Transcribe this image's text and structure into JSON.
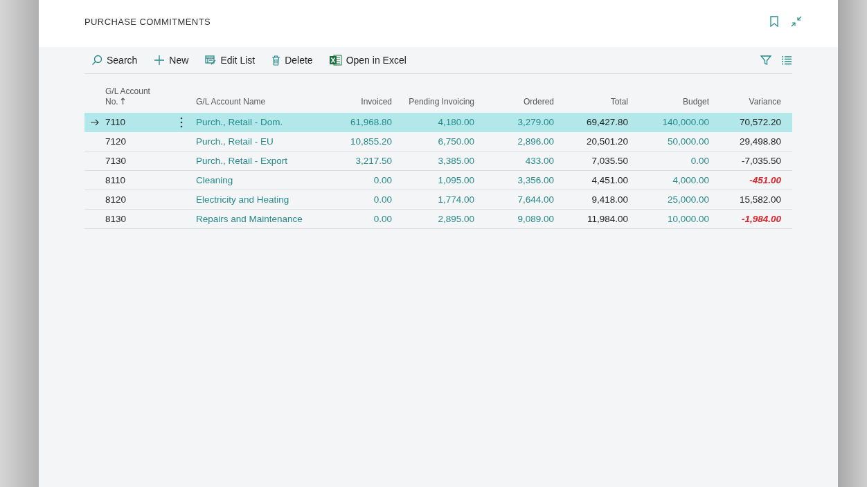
{
  "page": {
    "title": "PURCHASE COMMITMENTS"
  },
  "toolbar": {
    "actions": [
      {
        "kind": "search",
        "label": "Search"
      },
      {
        "kind": "new",
        "label": "New"
      },
      {
        "kind": "edit",
        "label": "Edit List"
      },
      {
        "kind": "delete",
        "label": "Delete"
      },
      {
        "kind": "excel",
        "label": "Open in Excel"
      }
    ]
  },
  "table": {
    "columns": [
      {
        "label": "G/L Account No.",
        "sorted": true
      },
      {
        "label": "G/L Account Name",
        "sorted": false
      },
      {
        "label": "Invoiced",
        "sorted": false
      },
      {
        "label": "Pending Invoicing",
        "sorted": false
      },
      {
        "label": "Ordered",
        "sorted": false
      },
      {
        "label": "Total",
        "sorted": false
      },
      {
        "label": "Budget",
        "sorted": false
      },
      {
        "label": "Variance",
        "sorted": false
      }
    ],
    "rows": [
      {
        "selected": true,
        "cells": [
          {
            "text": "7110",
            "kind": "plain"
          },
          {
            "text": "Purch., Retail - Dom.",
            "kind": "link"
          },
          {
            "text": "61,968.80",
            "kind": "link"
          },
          {
            "text": "4,180.00",
            "kind": "link"
          },
          {
            "text": "3,279.00",
            "kind": "link"
          },
          {
            "text": "69,427.80",
            "kind": "plain"
          },
          {
            "text": "140,000.00",
            "kind": "link"
          },
          {
            "text": "70,572.20",
            "kind": "plain"
          }
        ]
      },
      {
        "selected": false,
        "cells": [
          {
            "text": "7120",
            "kind": "plain"
          },
          {
            "text": "Purch., Retail - EU",
            "kind": "link"
          },
          {
            "text": "10,855.20",
            "kind": "link"
          },
          {
            "text": "6,750.00",
            "kind": "link"
          },
          {
            "text": "2,896.00",
            "kind": "link"
          },
          {
            "text": "20,501.20",
            "kind": "plain"
          },
          {
            "text": "50,000.00",
            "kind": "link"
          },
          {
            "text": "29,498.80",
            "kind": "plain"
          }
        ]
      },
      {
        "selected": false,
        "cells": [
          {
            "text": "7130",
            "kind": "plain"
          },
          {
            "text": "Purch., Retail - Export",
            "kind": "link"
          },
          {
            "text": "3,217.50",
            "kind": "link"
          },
          {
            "text": "3,385.00",
            "kind": "link"
          },
          {
            "text": "433.00",
            "kind": "link"
          },
          {
            "text": "7,035.50",
            "kind": "plain"
          },
          {
            "text": "0.00",
            "kind": "link"
          },
          {
            "text": "-7,035.50",
            "kind": "plain"
          }
        ]
      },
      {
        "selected": false,
        "cells": [
          {
            "text": "8110",
            "kind": "plain"
          },
          {
            "text": "Cleaning",
            "kind": "link"
          },
          {
            "text": "0.00",
            "kind": "link"
          },
          {
            "text": "1,095.00",
            "kind": "link"
          },
          {
            "text": "3,356.00",
            "kind": "link"
          },
          {
            "text": "4,451.00",
            "kind": "plain"
          },
          {
            "text": "4,000.00",
            "kind": "link"
          },
          {
            "text": "-451.00",
            "kind": "alert"
          }
        ]
      },
      {
        "selected": false,
        "cells": [
          {
            "text": "8120",
            "kind": "plain"
          },
          {
            "text": "Electricity and Heating",
            "kind": "link"
          },
          {
            "text": "0.00",
            "kind": "link"
          },
          {
            "text": "1,774.00",
            "kind": "link"
          },
          {
            "text": "7,644.00",
            "kind": "link"
          },
          {
            "text": "9,418.00",
            "kind": "plain"
          },
          {
            "text": "25,000.00",
            "kind": "link"
          },
          {
            "text": "15,582.00",
            "kind": "plain"
          }
        ]
      },
      {
        "selected": false,
        "cells": [
          {
            "text": "8130",
            "kind": "plain"
          },
          {
            "text": "Repairs and Maintenance",
            "kind": "link"
          },
          {
            "text": "0.00",
            "kind": "link"
          },
          {
            "text": "2,895.00",
            "kind": "link"
          },
          {
            "text": "9,089.00",
            "kind": "link"
          },
          {
            "text": "11,984.00",
            "kind": "plain"
          },
          {
            "text": "10,000.00",
            "kind": "link"
          },
          {
            "text": "-1,984.00",
            "kind": "alert"
          }
        ]
      }
    ]
  }
}
